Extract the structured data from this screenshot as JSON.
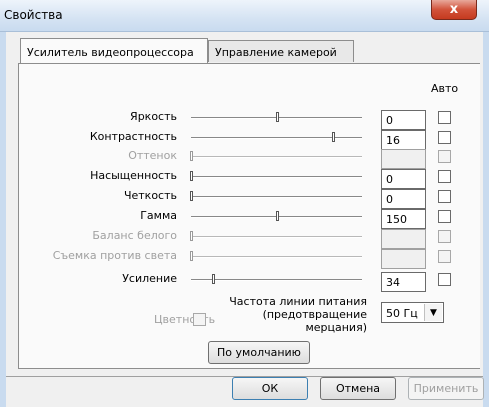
{
  "window": {
    "title": "Свойства",
    "close_glyph": "x"
  },
  "tabs": [
    {
      "label": "Усилитель видеопроцессора",
      "active": true
    },
    {
      "label": "Управление камерой",
      "active": false
    }
  ],
  "auto_header": "Авто",
  "rows": [
    {
      "label": "Яркость",
      "value": "0",
      "level": 0.5,
      "enabled": true
    },
    {
      "label": "Контрастность",
      "value": "16",
      "level": 0.83,
      "enabled": true
    },
    {
      "label": "Оттенок",
      "value": "",
      "level": 0.0,
      "enabled": false
    },
    {
      "label": "Насыщенность",
      "value": "0",
      "level": 0.0,
      "enabled": true
    },
    {
      "label": "Четкость",
      "value": "0",
      "level": 0.0,
      "enabled": true
    },
    {
      "label": "Гамма",
      "value": "150",
      "level": 0.5,
      "enabled": true
    },
    {
      "label": "Баланс белого",
      "value": "",
      "level": 0.0,
      "enabled": false
    },
    {
      "label": "Съемка против света",
      "value": "",
      "level": 0.0,
      "enabled": false
    },
    {
      "label": "Усиление",
      "value": "34",
      "level": 0.13,
      "enabled": true
    }
  ],
  "color": {
    "label": "Цветность"
  },
  "power_line": {
    "label_lines": [
      "Частота линии питания",
      "(предотвращение",
      "мерцания)"
    ],
    "selected": "50 Гц"
  },
  "buttons": {
    "defaults": "По умолчанию",
    "ok": "ОК",
    "cancel": "Отмена",
    "apply": "Применить"
  }
}
